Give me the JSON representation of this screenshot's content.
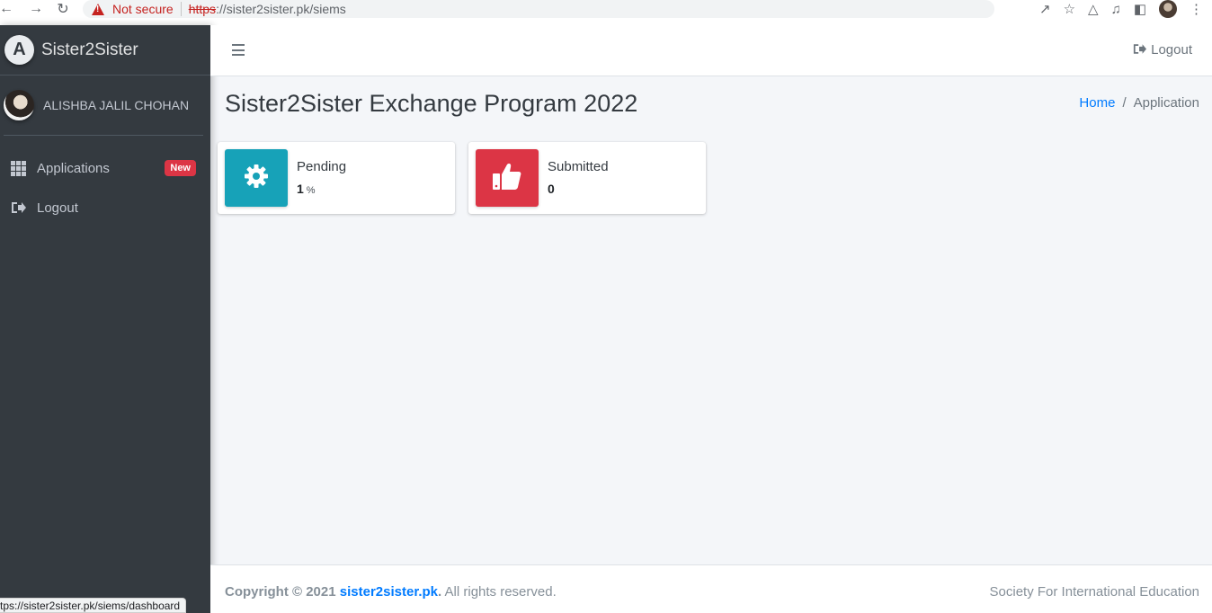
{
  "browser": {
    "security_label": "Not secure",
    "url_scheme": "https",
    "url_rest": "://sister2sister.pk/siems",
    "status_url": "tps://sister2sister.pk/siems/dashboard"
  },
  "sidebar": {
    "brand": "Sister2Sister",
    "brand_logo_letter": "A",
    "user_name": "ALISHBA JALIL CHOHAN",
    "items": [
      {
        "label": "Applications",
        "icon": "grid-icon",
        "badge": "New"
      },
      {
        "label": "Logout",
        "icon": "sign-out-icon"
      }
    ]
  },
  "header": {
    "logout_label": "Logout"
  },
  "content": {
    "title": "Sister2Sister Exchange Program 2022",
    "breadcrumb": {
      "home": "Home",
      "separator": "/",
      "current": "Application"
    },
    "cards": [
      {
        "label": "Pending",
        "value": "1",
        "unit": "%",
        "icon": "gear-icon",
        "color": "#17a2b8"
      },
      {
        "label": "Submitted",
        "value": "0",
        "icon": "thumbs-up-icon",
        "color": "#dc3545"
      }
    ]
  },
  "footer": {
    "copyright": "Copyright © 2021",
    "link": "sister2sister.pk",
    "period": ".",
    "rights": " All rights reserved.",
    "right_text": "Society For International Education"
  }
}
